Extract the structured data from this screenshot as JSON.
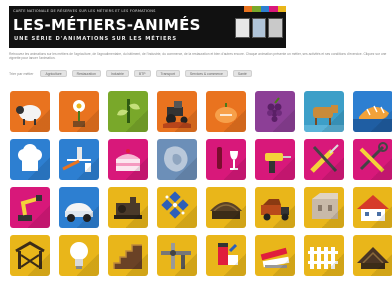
{
  "banner": {
    "top_line": "CARTE NATIONALE DE RÉSERVES SUR LES MÉTIERS ET LES FORMATIONS",
    "title": "LES-MÉTIERS-ANIMÉS",
    "subtitle": "UNE SÉRIE D'ANIMATIONS SUR LES MÉTIERS"
  },
  "intro": "Retrouvez les animations sur les métiers de l'agriculture, de l'agroalimentaire, du bâtiment, de l'industrie, du commerce, de la restauration et bien d'autres encore. Chaque animation présente un métier, ses activités et ses conditions d'exercice. Cliquez sur une vignette pour lancer l'animation.",
  "filters": {
    "label": "Trier par métier",
    "chips": [
      "Agriculture",
      "Restauration",
      "Industrie",
      "BTP",
      "Transport",
      "Services & commerce",
      "Santé"
    ]
  },
  "colors": {
    "orange": "#e9731f",
    "green": "#79a82a",
    "teal": "#3d9fc8",
    "magenta": "#d8187a",
    "purple": "#8c3f96",
    "yellow": "#e9b61a",
    "blue": "#2d7fd1"
  },
  "tiles": [
    {
      "name": "tile-sheep",
      "icon": "sheep-icon",
      "color": "#e9731f"
    },
    {
      "name": "tile-flower",
      "icon": "flower-icon",
      "color": "#e9731f"
    },
    {
      "name": "tile-plant",
      "icon": "plant-icon",
      "color": "#79a82a"
    },
    {
      "name": "tile-tractor",
      "icon": "tractor-icon",
      "color": "#e9731f"
    },
    {
      "name": "tile-pumpkin",
      "icon": "pumpkin-icon",
      "color": "#e9731f"
    },
    {
      "name": "tile-grapes",
      "icon": "grapes-icon",
      "color": "#8c3f96"
    },
    {
      "name": "tile-cow",
      "icon": "cow-icon",
      "color": "#3d9fc8"
    },
    {
      "name": "tile-bread",
      "icon": "bread-icon",
      "color": "#2d7fd1"
    },
    {
      "name": "tile-chef-hat",
      "icon": "chef-hat-icon",
      "color": "#2d7fd1"
    },
    {
      "name": "tile-waiter",
      "icon": "waiter-icon",
      "color": "#2d7fd1"
    },
    {
      "name": "tile-cake",
      "icon": "cake-icon",
      "color": "#d8187a"
    },
    {
      "name": "tile-stain",
      "icon": "stain-icon",
      "color": "#6c8fb8"
    },
    {
      "name": "tile-wine",
      "icon": "wine-icon",
      "color": "#d8187a"
    },
    {
      "name": "tile-drill",
      "icon": "drill-icon",
      "color": "#d8187a"
    },
    {
      "name": "tile-screwdriver",
      "icon": "screwdriver-icon",
      "color": "#d8187a"
    },
    {
      "name": "tile-tools",
      "icon": "tools-icon",
      "color": "#d8187a"
    },
    {
      "name": "tile-robot-arm",
      "icon": "robot-arm-icon",
      "color": "#d8187a"
    },
    {
      "name": "tile-car",
      "icon": "car-icon",
      "color": "#2d7fd1"
    },
    {
      "name": "tile-machine",
      "icon": "machine-icon",
      "color": "#e9b61a"
    },
    {
      "name": "tile-pattern",
      "icon": "pattern-icon",
      "color": "#e9b61a"
    },
    {
      "name": "tile-barn",
      "icon": "barn-icon",
      "color": "#e9b61a"
    },
    {
      "name": "tile-truck",
      "icon": "truck-icon",
      "color": "#e9b61a"
    },
    {
      "name": "tile-walls",
      "icon": "walls-icon",
      "color": "#e9b61a"
    },
    {
      "name": "tile-house",
      "icon": "house-icon",
      "color": "#e9b61a"
    },
    {
      "name": "tile-frame",
      "icon": "frame-icon",
      "color": "#e9b61a"
    },
    {
      "name": "tile-bulb",
      "icon": "bulb-icon",
      "color": "#e9b61a"
    },
    {
      "name": "tile-stairs",
      "icon": "stairs-icon",
      "color": "#e9b61a"
    },
    {
      "name": "tile-pipes",
      "icon": "pipes-icon",
      "color": "#e9b61a"
    },
    {
      "name": "tile-paint",
      "icon": "paint-icon",
      "color": "#e9b61a"
    },
    {
      "name": "tile-panels",
      "icon": "panels-icon",
      "color": "#e9b61a"
    },
    {
      "name": "tile-fence",
      "icon": "fence-icon",
      "color": "#e9b61a"
    },
    {
      "name": "tile-roof",
      "icon": "roof-icon",
      "color": "#e9b61a"
    }
  ]
}
